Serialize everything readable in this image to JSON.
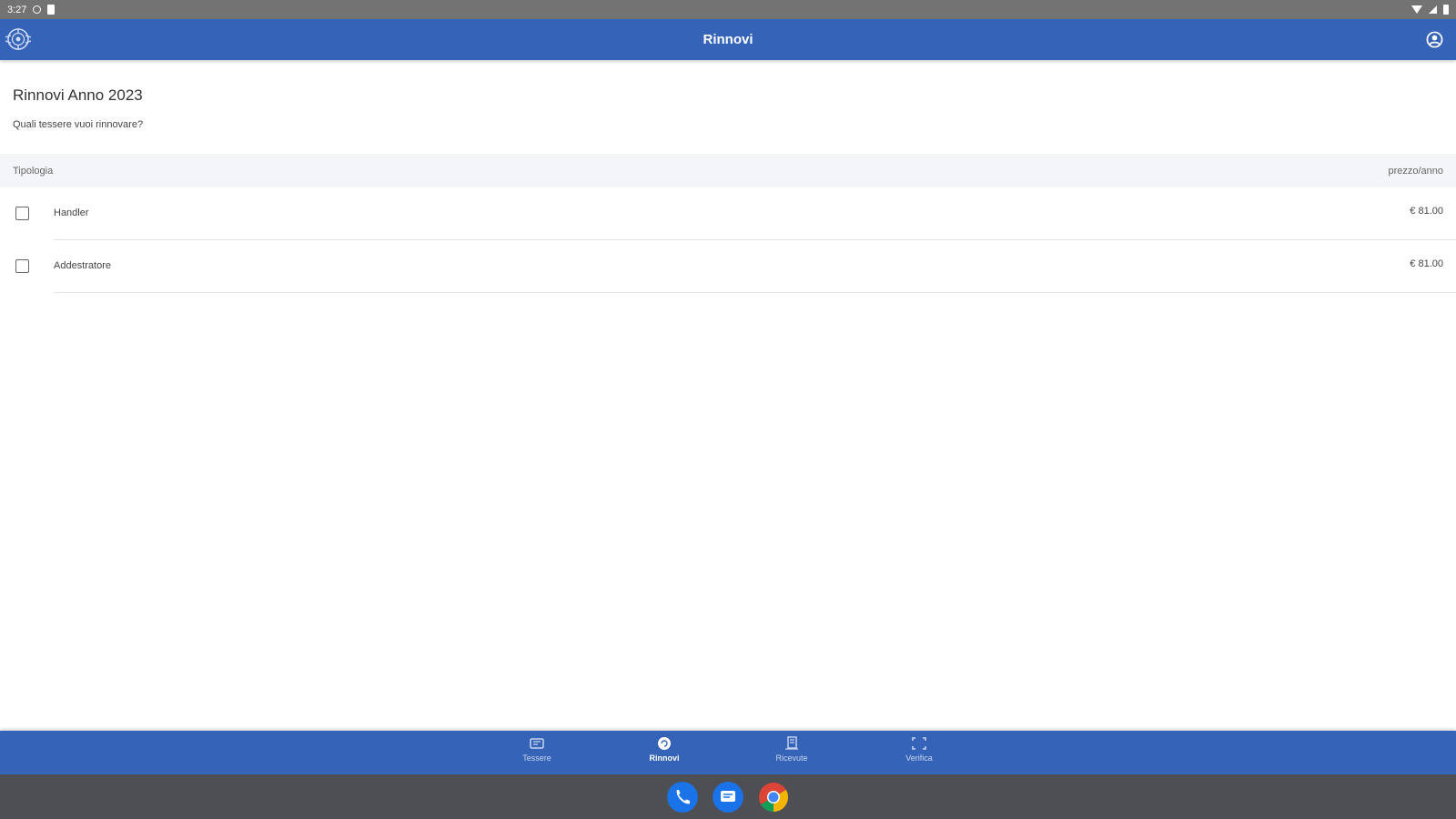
{
  "status_bar": {
    "time": "3:27"
  },
  "app_bar": {
    "title": "Rinnovi",
    "logo_icon": "emblem-icon",
    "account_icon": "account-circle-icon"
  },
  "main": {
    "heading": "Rinnovi Anno 2023",
    "question": "Quali tessere vuoi rinnovare?",
    "table": {
      "columns": [
        "Tipologia",
        "prezzo/anno"
      ],
      "rows": [
        {
          "label": "Handler",
          "price": "€ 81.00",
          "checked": false
        },
        {
          "label": "Addestratore",
          "price": "€ 81.00",
          "checked": false
        }
      ]
    }
  },
  "bottom_nav": {
    "items": [
      {
        "label": "Tessere",
        "icon": "id-card-icon",
        "active": false
      },
      {
        "label": "Rinnovi",
        "icon": "renew-circle-icon",
        "active": true
      },
      {
        "label": "Ricevute",
        "icon": "receipt-icon",
        "active": false
      },
      {
        "label": "Verifica",
        "icon": "qr-scan-icon",
        "active": false
      }
    ]
  },
  "taskbar": {
    "apps": [
      "phone-icon",
      "messages-icon",
      "chrome-icon"
    ]
  },
  "colors": {
    "primary": "#3563b7",
    "status_bar": "#737373",
    "taskbar": "#4e4f52"
  }
}
